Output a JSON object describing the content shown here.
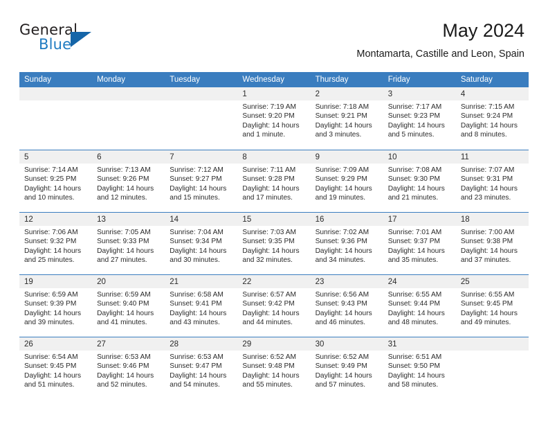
{
  "logo": {
    "text_top": "General",
    "text_bottom": "Blue",
    "triangle_icon": "triangle-icon",
    "color_dark": "#231f20",
    "color_blue": "#1f7bc1"
  },
  "header": {
    "title": "May 2024",
    "subtitle": "Montamarta, Castille and Leon, Spain"
  },
  "theme": {
    "header_blue": "#3a7dbf",
    "day_band_gray": "#f0f0f0"
  },
  "calendar": {
    "weekdays": [
      "Sunday",
      "Monday",
      "Tuesday",
      "Wednesday",
      "Thursday",
      "Friday",
      "Saturday"
    ],
    "weeks": [
      [
        {
          "day": "",
          "sunrise": "",
          "sunset": "",
          "daylight": "",
          "daylight2": ""
        },
        {
          "day": "",
          "sunrise": "",
          "sunset": "",
          "daylight": "",
          "daylight2": ""
        },
        {
          "day": "",
          "sunrise": "",
          "sunset": "",
          "daylight": "",
          "daylight2": ""
        },
        {
          "day": "1",
          "sunrise": "Sunrise: 7:19 AM",
          "sunset": "Sunset: 9:20 PM",
          "daylight": "Daylight: 14 hours",
          "daylight2": "and 1 minute."
        },
        {
          "day": "2",
          "sunrise": "Sunrise: 7:18 AM",
          "sunset": "Sunset: 9:21 PM",
          "daylight": "Daylight: 14 hours",
          "daylight2": "and 3 minutes."
        },
        {
          "day": "3",
          "sunrise": "Sunrise: 7:17 AM",
          "sunset": "Sunset: 9:23 PM",
          "daylight": "Daylight: 14 hours",
          "daylight2": "and 5 minutes."
        },
        {
          "day": "4",
          "sunrise": "Sunrise: 7:15 AM",
          "sunset": "Sunset: 9:24 PM",
          "daylight": "Daylight: 14 hours",
          "daylight2": "and 8 minutes."
        }
      ],
      [
        {
          "day": "5",
          "sunrise": "Sunrise: 7:14 AM",
          "sunset": "Sunset: 9:25 PM",
          "daylight": "Daylight: 14 hours",
          "daylight2": "and 10 minutes."
        },
        {
          "day": "6",
          "sunrise": "Sunrise: 7:13 AM",
          "sunset": "Sunset: 9:26 PM",
          "daylight": "Daylight: 14 hours",
          "daylight2": "and 12 minutes."
        },
        {
          "day": "7",
          "sunrise": "Sunrise: 7:12 AM",
          "sunset": "Sunset: 9:27 PM",
          "daylight": "Daylight: 14 hours",
          "daylight2": "and 15 minutes."
        },
        {
          "day": "8",
          "sunrise": "Sunrise: 7:11 AM",
          "sunset": "Sunset: 9:28 PM",
          "daylight": "Daylight: 14 hours",
          "daylight2": "and 17 minutes."
        },
        {
          "day": "9",
          "sunrise": "Sunrise: 7:09 AM",
          "sunset": "Sunset: 9:29 PM",
          "daylight": "Daylight: 14 hours",
          "daylight2": "and 19 minutes."
        },
        {
          "day": "10",
          "sunrise": "Sunrise: 7:08 AM",
          "sunset": "Sunset: 9:30 PM",
          "daylight": "Daylight: 14 hours",
          "daylight2": "and 21 minutes."
        },
        {
          "day": "11",
          "sunrise": "Sunrise: 7:07 AM",
          "sunset": "Sunset: 9:31 PM",
          "daylight": "Daylight: 14 hours",
          "daylight2": "and 23 minutes."
        }
      ],
      [
        {
          "day": "12",
          "sunrise": "Sunrise: 7:06 AM",
          "sunset": "Sunset: 9:32 PM",
          "daylight": "Daylight: 14 hours",
          "daylight2": "and 25 minutes."
        },
        {
          "day": "13",
          "sunrise": "Sunrise: 7:05 AM",
          "sunset": "Sunset: 9:33 PM",
          "daylight": "Daylight: 14 hours",
          "daylight2": "and 27 minutes."
        },
        {
          "day": "14",
          "sunrise": "Sunrise: 7:04 AM",
          "sunset": "Sunset: 9:34 PM",
          "daylight": "Daylight: 14 hours",
          "daylight2": "and 30 minutes."
        },
        {
          "day": "15",
          "sunrise": "Sunrise: 7:03 AM",
          "sunset": "Sunset: 9:35 PM",
          "daylight": "Daylight: 14 hours",
          "daylight2": "and 32 minutes."
        },
        {
          "day": "16",
          "sunrise": "Sunrise: 7:02 AM",
          "sunset": "Sunset: 9:36 PM",
          "daylight": "Daylight: 14 hours",
          "daylight2": "and 34 minutes."
        },
        {
          "day": "17",
          "sunrise": "Sunrise: 7:01 AM",
          "sunset": "Sunset: 9:37 PM",
          "daylight": "Daylight: 14 hours",
          "daylight2": "and 35 minutes."
        },
        {
          "day": "18",
          "sunrise": "Sunrise: 7:00 AM",
          "sunset": "Sunset: 9:38 PM",
          "daylight": "Daylight: 14 hours",
          "daylight2": "and 37 minutes."
        }
      ],
      [
        {
          "day": "19",
          "sunrise": "Sunrise: 6:59 AM",
          "sunset": "Sunset: 9:39 PM",
          "daylight": "Daylight: 14 hours",
          "daylight2": "and 39 minutes."
        },
        {
          "day": "20",
          "sunrise": "Sunrise: 6:59 AM",
          "sunset": "Sunset: 9:40 PM",
          "daylight": "Daylight: 14 hours",
          "daylight2": "and 41 minutes."
        },
        {
          "day": "21",
          "sunrise": "Sunrise: 6:58 AM",
          "sunset": "Sunset: 9:41 PM",
          "daylight": "Daylight: 14 hours",
          "daylight2": "and 43 minutes."
        },
        {
          "day": "22",
          "sunrise": "Sunrise: 6:57 AM",
          "sunset": "Sunset: 9:42 PM",
          "daylight": "Daylight: 14 hours",
          "daylight2": "and 44 minutes."
        },
        {
          "day": "23",
          "sunrise": "Sunrise: 6:56 AM",
          "sunset": "Sunset: 9:43 PM",
          "daylight": "Daylight: 14 hours",
          "daylight2": "and 46 minutes."
        },
        {
          "day": "24",
          "sunrise": "Sunrise: 6:55 AM",
          "sunset": "Sunset: 9:44 PM",
          "daylight": "Daylight: 14 hours",
          "daylight2": "and 48 minutes."
        },
        {
          "day": "25",
          "sunrise": "Sunrise: 6:55 AM",
          "sunset": "Sunset: 9:45 PM",
          "daylight": "Daylight: 14 hours",
          "daylight2": "and 49 minutes."
        }
      ],
      [
        {
          "day": "26",
          "sunrise": "Sunrise: 6:54 AM",
          "sunset": "Sunset: 9:45 PM",
          "daylight": "Daylight: 14 hours",
          "daylight2": "and 51 minutes."
        },
        {
          "day": "27",
          "sunrise": "Sunrise: 6:53 AM",
          "sunset": "Sunset: 9:46 PM",
          "daylight": "Daylight: 14 hours",
          "daylight2": "and 52 minutes."
        },
        {
          "day": "28",
          "sunrise": "Sunrise: 6:53 AM",
          "sunset": "Sunset: 9:47 PM",
          "daylight": "Daylight: 14 hours",
          "daylight2": "and 54 minutes."
        },
        {
          "day": "29",
          "sunrise": "Sunrise: 6:52 AM",
          "sunset": "Sunset: 9:48 PM",
          "daylight": "Daylight: 14 hours",
          "daylight2": "and 55 minutes."
        },
        {
          "day": "30",
          "sunrise": "Sunrise: 6:52 AM",
          "sunset": "Sunset: 9:49 PM",
          "daylight": "Daylight: 14 hours",
          "daylight2": "and 57 minutes."
        },
        {
          "day": "31",
          "sunrise": "Sunrise: 6:51 AM",
          "sunset": "Sunset: 9:50 PM",
          "daylight": "Daylight: 14 hours",
          "daylight2": "and 58 minutes."
        },
        {
          "day": "",
          "sunrise": "",
          "sunset": "",
          "daylight": "",
          "daylight2": ""
        }
      ]
    ]
  }
}
